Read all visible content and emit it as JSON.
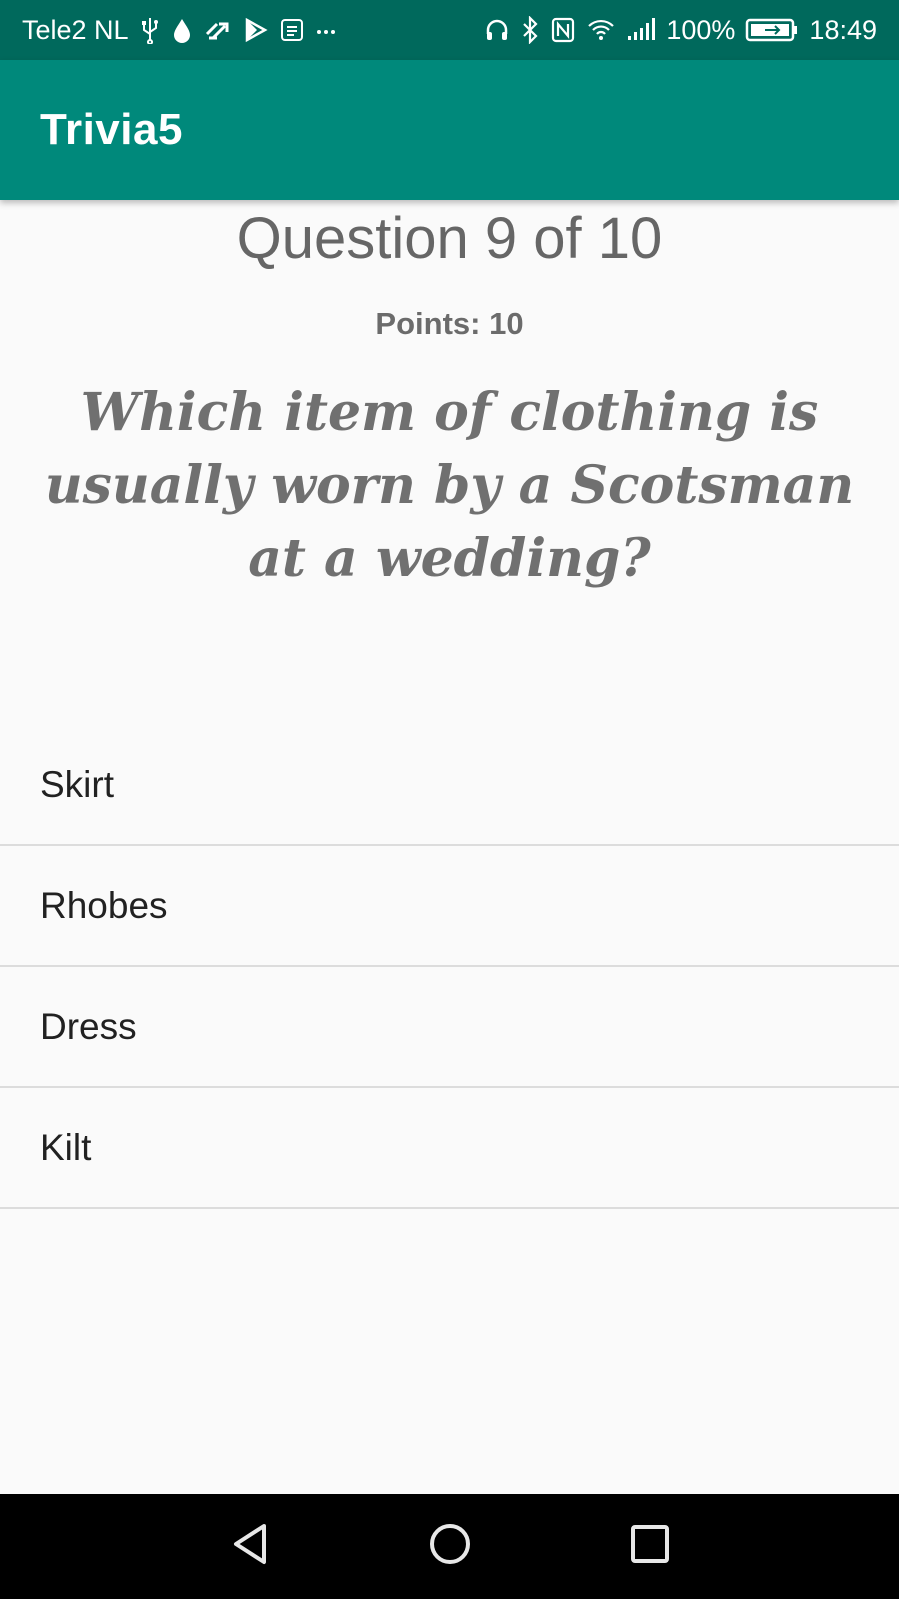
{
  "status_bar": {
    "carrier": "Tele2 NL",
    "battery": "100%",
    "time": "18:49",
    "left_icons": [
      "usb-icon",
      "drop-icon",
      "sync-icon",
      "play-store-icon",
      "notes-icon",
      "more-icon"
    ],
    "right_icons": [
      "headphones-icon",
      "bluetooth-icon",
      "nfc-icon",
      "wifi-icon",
      "signal-icon",
      "battery-icon"
    ]
  },
  "app_bar": {
    "title": "Trivia5"
  },
  "quiz": {
    "counter": "Question 9 of 10",
    "points": "Points: 10",
    "question": "Which item of clothing is usually worn by a Scotsman at a wedding?",
    "answers": [
      "Skirt",
      "Rhobes",
      "Dress",
      "Kilt"
    ]
  },
  "nav_bar": {
    "icons": [
      "back-icon",
      "home-icon",
      "recents-icon"
    ]
  },
  "colors": {
    "status_bar": "#00695c",
    "app_bar": "#00897b",
    "background": "#fafafa"
  }
}
